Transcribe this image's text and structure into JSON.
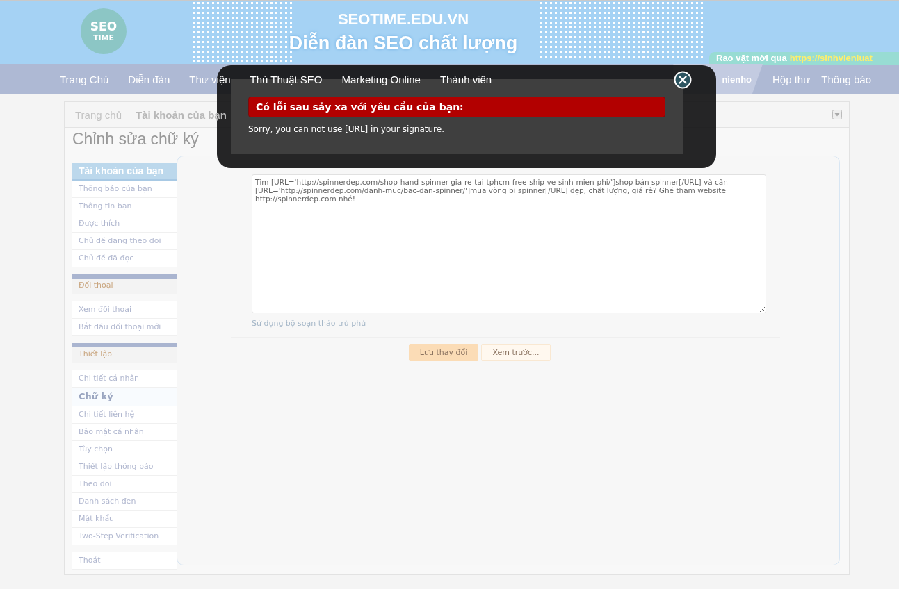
{
  "header": {
    "logo": {
      "top": "SEO",
      "bottom": "TIME"
    },
    "site_title": "SEOTIME.EDU.VN",
    "tagline": "Diễn đàn SEO chất lượng",
    "ticker": {
      "text": "Rao vặt mời qua",
      "link": "https://sinhvienluat"
    }
  },
  "nav": {
    "items": [
      {
        "label": "Trang Chủ"
      },
      {
        "label": "Diễn đàn"
      },
      {
        "label": "Thư viện"
      },
      {
        "label": "Thủ Thuật SEO"
      },
      {
        "label": "Marketing Online"
      },
      {
        "label": "Thành viên"
      }
    ],
    "user": "nienho",
    "right_items": [
      {
        "label": "Hộp thư"
      },
      {
        "label": "Thông báo"
      }
    ]
  },
  "breadcrumb": [
    {
      "label": "Trang chủ"
    },
    {
      "label": "Tài khoản của bạn"
    }
  ],
  "page_title": "Chỉnh sửa chữ ký",
  "sidebar": [
    {
      "kind": "primary",
      "title": "Tài khoản của bạn",
      "items": [
        {
          "label": "Thông báo của bạn",
          "selected": false
        },
        {
          "label": "Thông tin bạn",
          "selected": false
        },
        {
          "label": "Được thích",
          "selected": false
        },
        {
          "label": "Chủ đề đang theo dõi",
          "selected": false
        },
        {
          "label": "Chủ đề đã đọc",
          "selected": false
        }
      ]
    },
    {
      "kind": "section",
      "title": "Đối thoại",
      "items": [
        {
          "label": "Xem đối thoại",
          "selected": false
        },
        {
          "label": "Bắt đầu đối thoại mới",
          "selected": false
        }
      ]
    },
    {
      "kind": "section",
      "title": "Thiết lập",
      "items": [
        {
          "label": "Chi tiết cá nhân",
          "selected": false
        },
        {
          "label": "Chữ ký",
          "selected": true
        },
        {
          "label": "Chi tiết liên hệ",
          "selected": false
        },
        {
          "label": "Bảo mật cá nhân",
          "selected": false
        },
        {
          "label": "Tùy chọn",
          "selected": false
        },
        {
          "label": "Thiết lập thông báo",
          "selected": false
        },
        {
          "label": "Theo dõi",
          "selected": false
        },
        {
          "label": "Danh sách đen",
          "selected": false
        },
        {
          "label": "Mật khẩu",
          "selected": false
        },
        {
          "label": "Two-Step Verification",
          "selected": false
        }
      ]
    },
    {
      "kind": "plain",
      "items": [
        {
          "label": "Thoát",
          "selected": false
        }
      ]
    }
  ],
  "editor": {
    "value": "Tìm [URL='http://spinnerdep.com/shop-hand-spinner-gia-re-tai-tphcm-free-ship-ve-sinh-mien-phi/']shop bán spinner[/URL] và cần [URL='http://spinnerdep.com/danh-muc/bac-dan-spinner/']mua vòng bi spinner[/URL] đẹp, chất lượng, giá rẻ? Ghé thăm website http://spinnerdep.com nhé!",
    "rich_editor_link": "Sử dụng bộ soạn thảo trù phú"
  },
  "buttons": [
    {
      "kind": "primary",
      "label": "Lưu thay đổi"
    },
    {
      "kind": "secondary",
      "label": "Xem trước..."
    }
  ],
  "modal": {
    "title": "Có lỗi sau sảy xa với yêu cầu của bạn:",
    "message": "Sorry, you can not use [URL] in your signature."
  }
}
